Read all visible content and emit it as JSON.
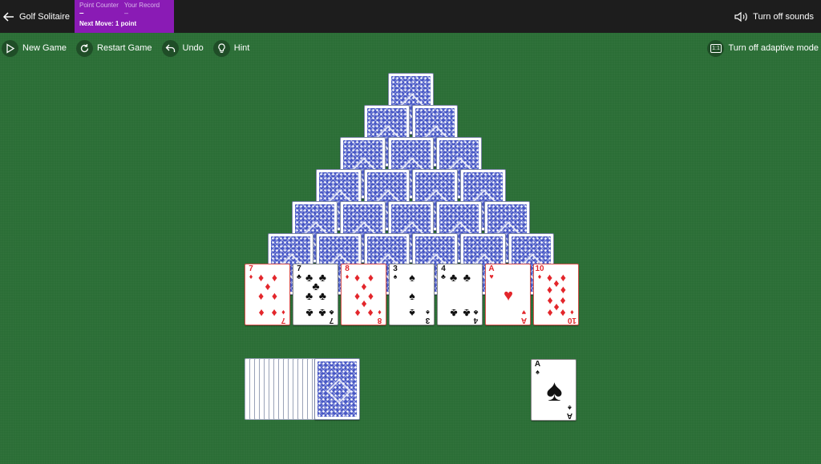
{
  "header": {
    "back_label": "Golf Solitaire",
    "points": {
      "counter_label": "Point Counter",
      "record_label": "Your Record",
      "counter_value": "–",
      "record_value": "–",
      "next_move": "Next Move: 1 point"
    },
    "sound_label": "Turn off sounds"
  },
  "toolbar": {
    "new_game": "New Game",
    "restart_game": "Restart Game",
    "undo": "Undo",
    "hint": "Hint",
    "adaptive_mode": "Turn off adaptive mode",
    "adaptive_icon_text": "1:1"
  },
  "game": {
    "pyramid_rows": [
      1,
      2,
      3,
      4,
      5,
      6
    ],
    "bottom_row": [
      {
        "rank": "7",
        "suit": "♦",
        "color": "red"
      },
      {
        "rank": "7",
        "suit": "♣",
        "color": "black"
      },
      {
        "rank": "8",
        "suit": "♦",
        "color": "red"
      },
      {
        "rank": "3",
        "suit": "♠",
        "color": "black"
      },
      {
        "rank": "4",
        "suit": "♣",
        "color": "black"
      },
      {
        "rank": "A",
        "suit": "♥",
        "color": "red"
      },
      {
        "rank": "10",
        "suit": "♦",
        "color": "red"
      }
    ],
    "stock_edges": 15,
    "waste_card": {
      "rank": "A",
      "suit": "♠",
      "color": "black"
    }
  },
  "colors": {
    "felt": "#2b6e36",
    "points_panel": "#8a1bb5",
    "card_back": "#4959c6",
    "red_suit": "#e3262b"
  }
}
